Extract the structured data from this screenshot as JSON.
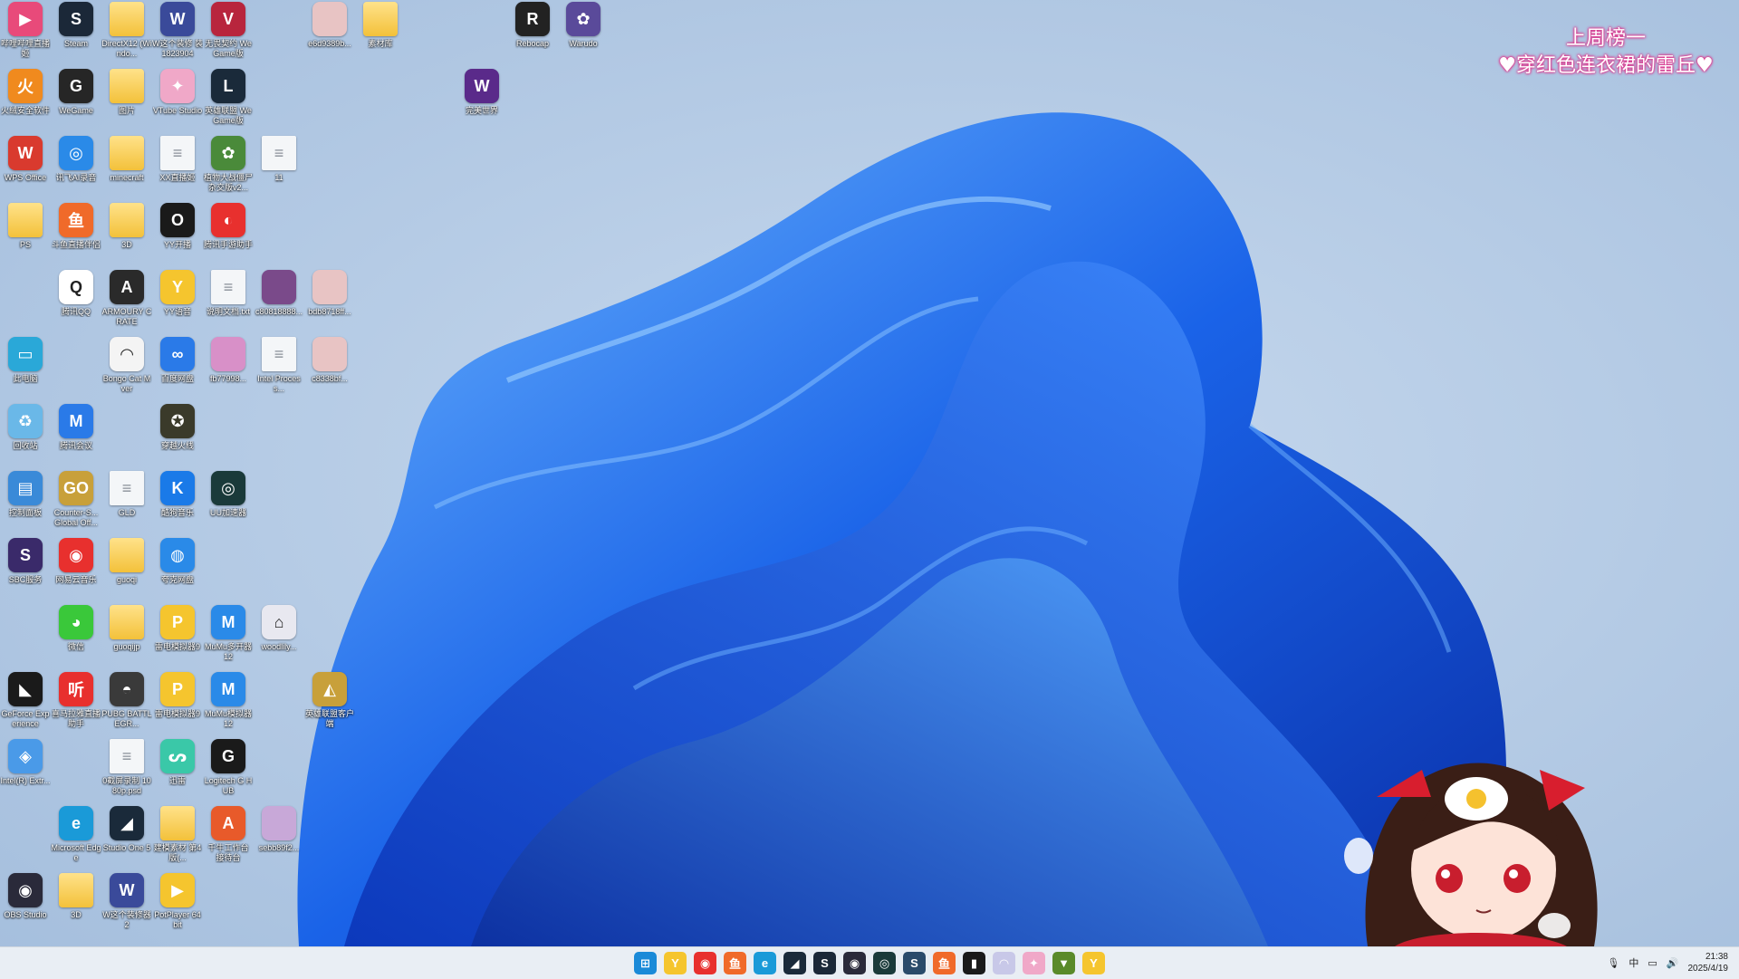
{
  "overlay_banner": {
    "line1": "上周榜一",
    "line2": "♥穿红色连衣裙的雷丘♥"
  },
  "desktop_icons": [
    {
      "id": "i0",
      "label": "哔哩哔哩直播姬",
      "glyph": "▶",
      "color": "#e84a7a"
    },
    {
      "id": "i1",
      "label": "Steam",
      "glyph": "S",
      "color": "#1b2838"
    },
    {
      "id": "i2",
      "label": "DirectX12 (Windo...",
      "glyph": "",
      "color": "folder"
    },
    {
      "id": "i3",
      "label": "W这个装修 装 1823904",
      "glyph": "W",
      "color": "#3a4a9a"
    },
    {
      "id": "i4",
      "label": "无畏契约 WeGame版",
      "glyph": "V",
      "color": "#b8253d"
    },
    {
      "id": "i5",
      "label": "e6d9389b...",
      "glyph": "",
      "color": "#e8c4c4"
    },
    {
      "id": "i6",
      "label": "素材库",
      "glyph": "",
      "color": "folder"
    },
    {
      "id": "i7",
      "label": "Rebocap",
      "glyph": "R",
      "color": "#222222"
    },
    {
      "id": "i8",
      "label": "Warudo",
      "glyph": "✿",
      "color": "#5a4a9a"
    },
    {
      "id": "i9",
      "label": "火绒安全软件",
      "glyph": "火",
      "color": "#f08a1e"
    },
    {
      "id": "i10",
      "label": "WeGame",
      "glyph": "G",
      "color": "#262626"
    },
    {
      "id": "i11",
      "label": "图片",
      "glyph": "",
      "color": "folder"
    },
    {
      "id": "i12",
      "label": "VTube Studio",
      "glyph": "✦",
      "color": "#f0a8c8"
    },
    {
      "id": "i13",
      "label": "英雄联盟 WeGame版",
      "glyph": "L",
      "color": "#1a2a3a"
    },
    {
      "id": "i14",
      "label": "完美世界",
      "glyph": "W",
      "color": "#5a2a8a"
    },
    {
      "id": "i15",
      "label": "WPS Office",
      "glyph": "W",
      "color": "#d93a2e"
    },
    {
      "id": "i16",
      "label": "讯飞AI录音",
      "glyph": "◎",
      "color": "#2a8ae8"
    },
    {
      "id": "i17",
      "label": "minecraft",
      "glyph": "",
      "color": "folder"
    },
    {
      "id": "i18",
      "label": "XX直播姬",
      "glyph": "",
      "color": "file"
    },
    {
      "id": "i19",
      "label": "植物大战僵尸杂交版v2...",
      "glyph": "✿",
      "color": "#4a8a3a"
    },
    {
      "id": "i20",
      "label": "11",
      "glyph": "",
      "color": "file"
    },
    {
      "id": "i21",
      "label": "PS",
      "glyph": "",
      "color": "folder"
    },
    {
      "id": "i22",
      "label": "斗鱼直播伴侣",
      "glyph": "鱼",
      "color": "#f06a2a"
    },
    {
      "id": "i23",
      "label": "3D",
      "glyph": "",
      "color": "folder"
    },
    {
      "id": "i24",
      "label": "YY开播",
      "glyph": "O",
      "color": "#1a1a1a"
    },
    {
      "id": "i25",
      "label": "腾讯手游助手",
      "glyph": "◐",
      "color": "#e8302e"
    },
    {
      "id": "i26",
      "label": "腾讯QQ",
      "glyph": "Q",
      "color": "#ffffff"
    },
    {
      "id": "i27",
      "label": "ARMOURY CRATE",
      "glyph": "A",
      "color": "#2a2a2a"
    },
    {
      "id": "i28",
      "label": "YY语音",
      "glyph": "Y",
      "color": "#f5c52e"
    },
    {
      "id": "i29",
      "label": "说明文档.txt",
      "glyph": "",
      "color": "file"
    },
    {
      "id": "i30",
      "label": "c80818888...",
      "glyph": "",
      "color": "#7a4a8a"
    },
    {
      "id": "i31",
      "label": "bdb8718ff...",
      "glyph": "",
      "color": "#e8c4c4"
    },
    {
      "id": "i32",
      "label": "此电脑",
      "glyph": "▭",
      "color": "#2aa8d8"
    },
    {
      "id": "i33",
      "label": "Bongo Cat Mver",
      "glyph": "◠",
      "color": "#f4f4f4"
    },
    {
      "id": "i34",
      "label": "百度网盘",
      "glyph": "∞",
      "color": "#2a7ae8"
    },
    {
      "id": "i35",
      "label": "fb77998...",
      "glyph": "",
      "color": "#d890c8"
    },
    {
      "id": "i36",
      "label": "Intel Process...",
      "glyph": "",
      "color": "file"
    },
    {
      "id": "i37",
      "label": "c8338bf...",
      "glyph": "",
      "color": "#e8c4c4"
    },
    {
      "id": "i38",
      "label": "回收站",
      "glyph": "♻",
      "color": "#6ab8e8"
    },
    {
      "id": "i39",
      "label": "腾讯会议",
      "glyph": "M",
      "color": "#2a7ae8"
    },
    {
      "id": "i40",
      "label": "穿越火线",
      "glyph": "✪",
      "color": "#3a3a2a"
    },
    {
      "id": "i41",
      "label": "控制面板",
      "glyph": "▤",
      "color": "#3a8ad8"
    },
    {
      "id": "i42",
      "label": "Counter-S... Global Off...",
      "glyph": "GO",
      "color": "#c8a03a"
    },
    {
      "id": "i43",
      "label": "GLD",
      "glyph": "",
      "color": "file"
    },
    {
      "id": "i44",
      "label": "酷狗音乐",
      "glyph": "K",
      "color": "#1a7ae8"
    },
    {
      "id": "i45",
      "label": "UU加速器",
      "glyph": "◎",
      "color": "#1a3a3a"
    },
    {
      "id": "i46",
      "label": "SBC服务",
      "glyph": "S",
      "color": "#3a2a6a"
    },
    {
      "id": "i47",
      "label": "网易云音乐",
      "glyph": "◉",
      "color": "#e8302e"
    },
    {
      "id": "i48",
      "label": "guoqi",
      "glyph": "",
      "color": "folder"
    },
    {
      "id": "i49",
      "label": "夸克网盘",
      "glyph": "◍",
      "color": "#2a8ae8"
    },
    {
      "id": "i50",
      "label": "微信",
      "glyph": "◕",
      "color": "#3ac83a"
    },
    {
      "id": "i51",
      "label": "guoqijp",
      "glyph": "",
      "color": "folder"
    },
    {
      "id": "i52",
      "label": "雷电模拟器9",
      "glyph": "P",
      "color": "#f5c52e"
    },
    {
      "id": "i53",
      "label": "MuMu多开器12",
      "glyph": "M",
      "color": "#2a8ae8"
    },
    {
      "id": "i54",
      "label": "woodlily...",
      "glyph": "⌂",
      "color": "#e8e8f0"
    },
    {
      "id": "i55",
      "label": "GeForce Experience",
      "glyph": "◣",
      "color": "#1a1a1a"
    },
    {
      "id": "i56",
      "label": "喜马拉雅直播助手",
      "glyph": "听",
      "color": "#e8302e"
    },
    {
      "id": "i57",
      "label": "PUBG BATTLEGR...",
      "glyph": "◓",
      "color": "#3a3a3a"
    },
    {
      "id": "i58",
      "label": "雷电模拟器9",
      "glyph": "P",
      "color": "#f5c52e"
    },
    {
      "id": "i59",
      "label": "MuMu模拟器12",
      "glyph": "M",
      "color": "#2a8ae8"
    },
    {
      "id": "i60",
      "label": "英雄联盟客户端",
      "glyph": "◭",
      "color": "#c8a03a"
    },
    {
      "id": "i61",
      "label": "Intel(R) Extr...",
      "glyph": "◈",
      "color": "#4a9ae8"
    },
    {
      "id": "i62",
      "label": "0截屏录制 1080p.psd",
      "glyph": "",
      "color": "file"
    },
    {
      "id": "i63",
      "label": "迅雷",
      "glyph": "ᔕ",
      "color": "#3ac8a8"
    },
    {
      "id": "i64",
      "label": "Logitech G HUB",
      "glyph": "G",
      "color": "#1a1a1a"
    },
    {
      "id": "i65",
      "label": "Microsoft Edge",
      "glyph": "e",
      "color": "#1a9ad8"
    },
    {
      "id": "i66",
      "label": "Studio One 5",
      "glyph": "◢",
      "color": "#1a2a3a"
    },
    {
      "id": "i67",
      "label": "建模素材 第4版(...",
      "glyph": "",
      "color": "folder"
    },
    {
      "id": "i68",
      "label": "千牛工作台 接待台",
      "glyph": "A",
      "color": "#e85a2a"
    },
    {
      "id": "i69",
      "label": "sebb89f2...",
      "glyph": "",
      "color": "#c8a8d8"
    },
    {
      "id": "i70",
      "label": "OBS Studio",
      "glyph": "◉",
      "color": "#2a2a3a"
    },
    {
      "id": "i71",
      "label": "3D",
      "glyph": "",
      "color": "folder"
    },
    {
      "id": "i72",
      "label": "W这个装修器2",
      "glyph": "W",
      "color": "#3a4a9a"
    },
    {
      "id": "i73",
      "label": "PotPlayer 64 bit",
      "glyph": "▶",
      "color": "#f5c52e"
    }
  ],
  "taskbar": {
    "icons": [
      {
        "name": "start-menu-icon",
        "glyph": "⊞",
        "color": "#1a8ad8"
      },
      {
        "name": "yy-voice-icon",
        "glyph": "Y",
        "color": "#f5c52e"
      },
      {
        "name": "netease-music-icon",
        "glyph": "◉",
        "color": "#e8302e"
      },
      {
        "name": "douyu-icon",
        "glyph": "鱼",
        "color": "#f06a2a"
      },
      {
        "name": "edge-icon",
        "glyph": "e",
        "color": "#1a9ad8"
      },
      {
        "name": "studio-one-icon",
        "glyph": "◢",
        "color": "#1a2a3a"
      },
      {
        "name": "steam-icon",
        "glyph": "S",
        "color": "#1b2838"
      },
      {
        "name": "obs-icon",
        "glyph": "◉",
        "color": "#2a2a3a"
      },
      {
        "name": "uu-booster-icon",
        "glyph": "◎",
        "color": "#1a3a3a"
      },
      {
        "name": "steam-icon-2",
        "glyph": "S",
        "color": "#2a4a6a"
      },
      {
        "name": "douyu-icon-2",
        "glyph": "鱼",
        "color": "#f06a2a"
      },
      {
        "name": "terminal-icon",
        "glyph": "▮",
        "color": "#1a1a1a"
      },
      {
        "name": "bongo-cat-icon",
        "glyph": "◠",
        "color": "#c8c8e8"
      },
      {
        "name": "vtube-studio-icon",
        "glyph": "✦",
        "color": "#f0a8c8"
      },
      {
        "name": "nvidia-icon",
        "glyph": "▼",
        "color": "#5a8a2a"
      },
      {
        "name": "yy-voice-icon-2",
        "glyph": "Y",
        "color": "#f5c52e"
      }
    ],
    "tray": {
      "ime": "中",
      "time": "21:38",
      "date": "2025/4/19"
    }
  }
}
